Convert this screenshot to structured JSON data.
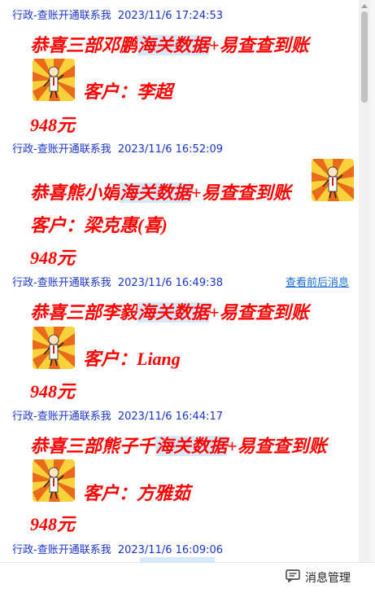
{
  "messages": [
    {
      "sender": "行政-查账开通联系我",
      "time": "2023/11/6 17:24:53",
      "headline_pre": "恭喜三部邓鹏",
      "headline_hl": "海关数据",
      "headline_post": "+易查查到账",
      "customer": "客户：李超",
      "price": "948元"
    },
    {
      "sender": "行政-查账开通联系我",
      "time": "2023/11/6 16:52:09",
      "headline_pre": "恭喜熊小娟",
      "headline_hl": "海关数据",
      "headline_post": "+易查查到账",
      "customer": "客户：梁克惠(喜)",
      "price": "948元"
    },
    {
      "sender": "行政-查账开通联系我",
      "time": "2023/11/6 16:49:38",
      "headline_pre": "恭喜三部李毅",
      "headline_hl": "海关数据",
      "headline_post": "+易查查到账",
      "customer": "客户：Liang",
      "price": "948元",
      "context_link": "查看前后消息"
    },
    {
      "sender": "行政-查账开通联系我",
      "time": "2023/11/6 16:44:17",
      "headline_pre": "恭喜三部熊子千",
      "headline_hl": "海关数据",
      "headline_post": "+易查查到账",
      "customer": "客户：方雅茹",
      "price": "948元"
    },
    {
      "sender": "行政-查账开通联系我",
      "time": "2023/11/6 16:09:06"
    }
  ],
  "footer": {
    "manage_label": "消息管理"
  },
  "colors": {
    "sender": "#1a35c8",
    "highlight_text": "#ff0000",
    "highlight_bg": "#d6e9fb"
  }
}
